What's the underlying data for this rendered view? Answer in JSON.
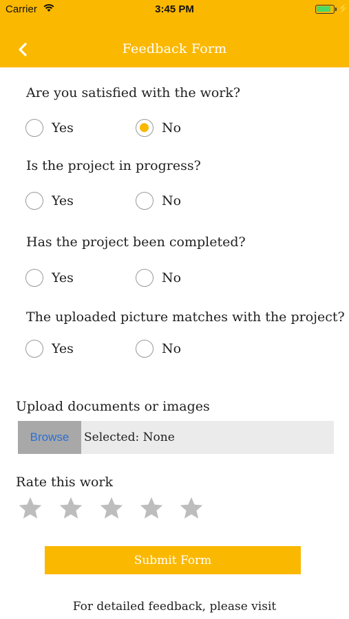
{
  "status_bar": {
    "carrier": "Carrier",
    "time": "3:45 PM"
  },
  "header": {
    "title": "Feedback Form",
    "background": "#fbb800"
  },
  "questions": [
    {
      "text": "Are you satisfied with the work?",
      "yes_label": "Yes",
      "no_label": "No",
      "selected": "No"
    },
    {
      "text": "Is the project in progress?",
      "yes_label": "Yes",
      "no_label": "No",
      "selected": null
    },
    {
      "text": "Has the project been completed?",
      "yes_label": "Yes",
      "no_label": "No",
      "selected": null
    },
    {
      "text": "The uploaded picture matches with the project?",
      "yes_label": "Yes",
      "no_label": "No",
      "selected": null
    }
  ],
  "upload": {
    "label": "Upload documents or images",
    "browse_label": "Browse",
    "selected_text": "Selected: None"
  },
  "rating": {
    "label": "Rate this work",
    "max": 5,
    "value": 0
  },
  "submit_label": "Submit Form",
  "footer_text": "For detailed feedback, please visit"
}
